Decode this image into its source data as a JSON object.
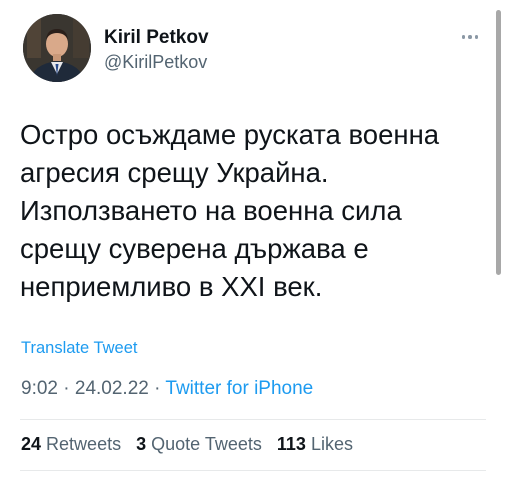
{
  "author": {
    "name": "Kiril Petkov",
    "handle": "@KirilPetkov"
  },
  "tweet": {
    "lines": [
      "Остро осъждаме руската военна",
      "агресия срещу Украйна.",
      "Използването на военна сила",
      "срещу суверена държава е",
      "неприемливо в XXI век."
    ],
    "translate_label": "Translate Tweet",
    "time": "9:02",
    "date": "24.02.22",
    "source": "Twitter for iPhone",
    "separator": "·"
  },
  "stats": {
    "retweets_count": "24",
    "retweets_label": "Retweets",
    "quotes_count": "3",
    "quotes_label": "Quote Tweets",
    "likes_count": "113",
    "likes_label": "Likes"
  },
  "colors": {
    "text": "#0f1419",
    "secondary": "#536471",
    "link": "#1d9bf0",
    "divider": "#e7e9ea"
  },
  "icons": {
    "more": "more-options-icon"
  }
}
